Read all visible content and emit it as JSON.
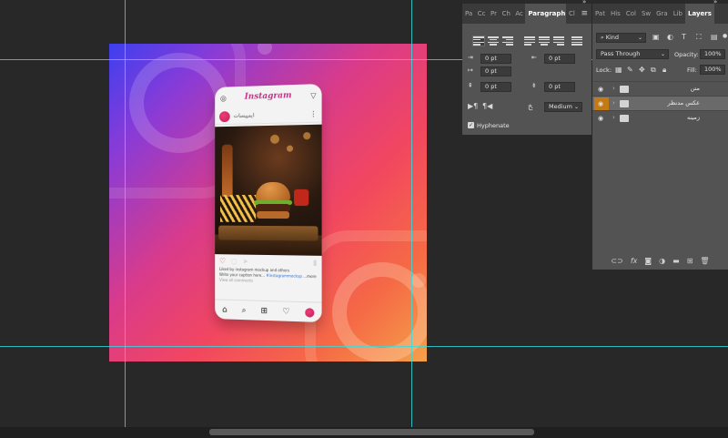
{
  "canvas": {
    "mockup": {
      "app_title": "Instagram",
      "username": "ایمپیسات",
      "caption_line1": "Liked by instagram mockup and others",
      "caption_line2": "Write your caption here...",
      "caption_tag": "#instagrammockup",
      "caption_more": "...more",
      "meta": "View all comments"
    }
  },
  "paragraph_panel": {
    "tabs": [
      "Pa",
      "Cc",
      "Pr",
      "Ch",
      "Ac",
      "Paragraph",
      "Cl"
    ],
    "active_tab": "Paragraph",
    "menu_glyph": "≡",
    "indent_left": "0 pt",
    "indent_right": "0 pt",
    "first_line": "0 pt",
    "space_before": "0 pt",
    "space_after": "0 pt",
    "composer_value": "Medium",
    "hyphenate_label": "Hyphenate",
    "hyphenate_checked": "✓"
  },
  "layers_panel": {
    "tabs": [
      "Pat",
      "His",
      "Col",
      "Sw",
      "Gra",
      "Lib",
      "Layers"
    ],
    "active_tab": "Layers",
    "filter_kind": "Kind",
    "blend_mode": "Pass Through",
    "opacity_label": "Opacity:",
    "opacity_value": "100%",
    "lock_label": "Lock:",
    "fill_label": "Fill:",
    "fill_value": "100%",
    "layers": [
      {
        "name": "متن",
        "selected": false
      },
      {
        "name": "عکس مدنظر",
        "selected": true
      },
      {
        "name": "زمینه",
        "selected": false
      }
    ],
    "footer_fx": "fx"
  },
  "colors": {
    "guide": "#2ee0e6",
    "selected_eye": "#c47a14",
    "workspace": "#282828"
  }
}
